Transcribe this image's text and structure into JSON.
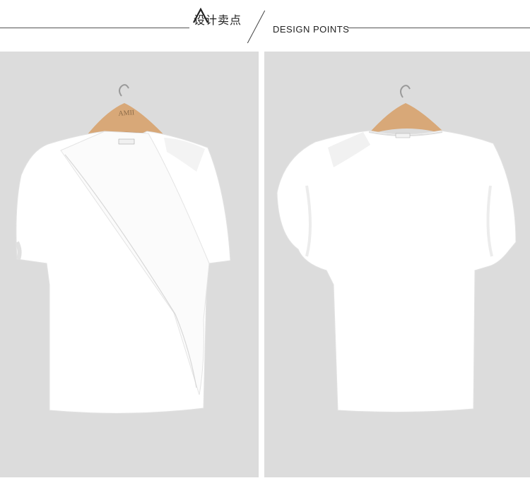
{
  "header": {
    "title_cn": "设计卖点",
    "title_en": "DESIGN POINTS",
    "mark_icon": "caret-up-icon"
  },
  "photos": {
    "front": {
      "hanger_brand": "AMII",
      "icon": "tshirt-front-icon"
    },
    "back": {
      "icon": "tshirt-back-icon"
    }
  },
  "colors": {
    "background": "#dcdcdc",
    "shirt": "#ffffff",
    "hanger": "#d8a878",
    "rule": "#555555"
  }
}
